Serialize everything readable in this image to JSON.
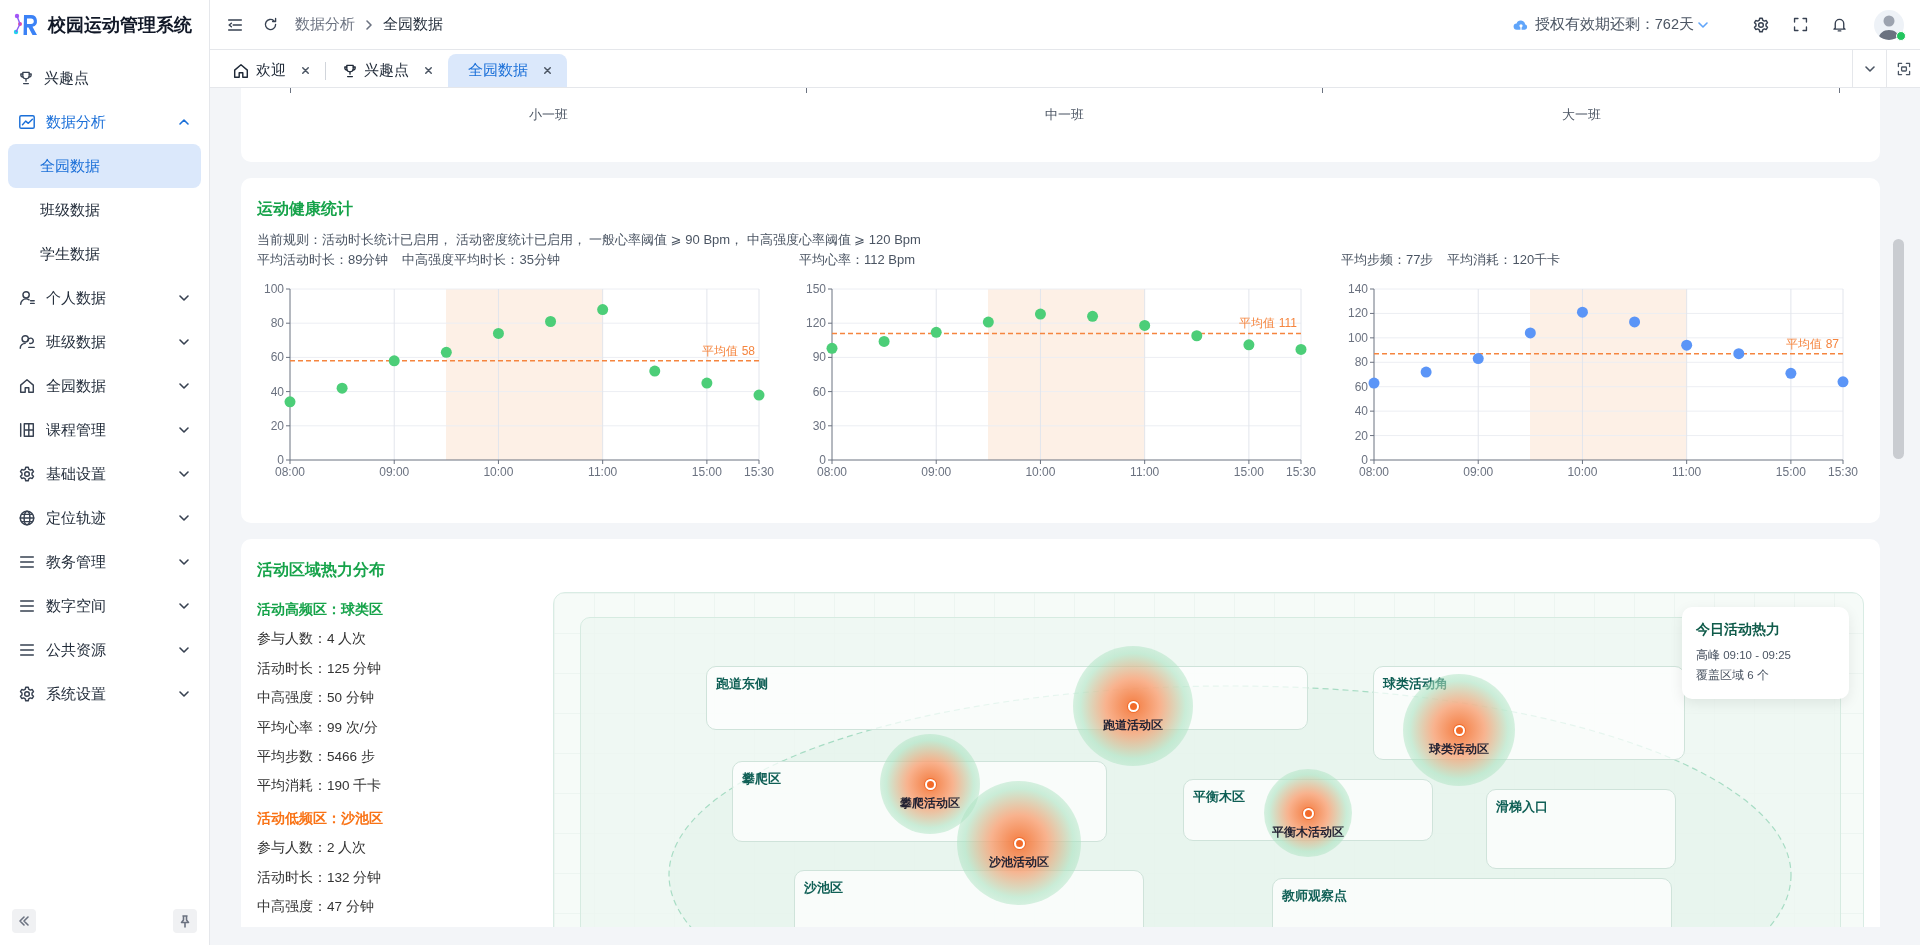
{
  "app": {
    "title": "校园运动管理系统"
  },
  "sidebar": {
    "items": [
      {
        "label": "兴趣点",
        "selected": false
      },
      {
        "label": "数据分析",
        "selected": false,
        "expanded": true,
        "children": [
          {
            "label": "全园数据",
            "selected": true
          },
          {
            "label": "班级数据",
            "selected": false
          },
          {
            "label": "学生数据",
            "selected": false
          }
        ]
      },
      {
        "label": "个人数据",
        "selected": false,
        "expanded": false
      },
      {
        "label": "班级数据",
        "selected": false,
        "expanded": false
      },
      {
        "label": "全园数据",
        "selected": false,
        "expanded": false
      },
      {
        "label": "课程管理",
        "selected": false,
        "expanded": false
      },
      {
        "label": "基础设置",
        "selected": false,
        "expanded": false
      },
      {
        "label": "定位轨迹",
        "selected": false,
        "expanded": false
      },
      {
        "label": "教务管理",
        "selected": false,
        "expanded": false
      },
      {
        "label": "数字空间",
        "selected": false,
        "expanded": false
      },
      {
        "label": "公共资源",
        "selected": false,
        "expanded": false
      },
      {
        "label": "系统设置",
        "selected": false,
        "expanded": false
      }
    ]
  },
  "header": {
    "breadcrumb": [
      "数据分析",
      "全园数据"
    ],
    "license": "授权有效期还剩：762天",
    "user": {
      "online": true
    }
  },
  "tabs": [
    {
      "label": "欢迎",
      "selected": false
    },
    {
      "label": "兴趣点",
      "selected": false
    },
    {
      "label": "全园数据",
      "selected": true
    }
  ],
  "class_chart": {
    "x_labels": [
      "小一班",
      "中一班",
      "大一班"
    ]
  },
  "health": {
    "title": "运动健康统计",
    "rules": "当前规则：活动时长统计已启用， 活动密度统计已启用， 一般心率阈值 ⩾ 90 Bpm， 中高强度心率阈值 ⩾ 120 Bpm",
    "charts": [
      {
        "stats": [
          "平均活动时长：89分钟",
          "中高强度平均时长：35分钟"
        ],
        "chart_data": {
          "type": "scatter",
          "categories": [
            "08:00",
            null,
            "09:00",
            null,
            "10:00",
            null,
            "11:00",
            null,
            "15:00",
            "15:30"
          ],
          "ylim": [
            0,
            100
          ],
          "yticks": [
            0,
            20,
            40,
            60,
            80,
            100
          ],
          "series": [
            {
              "color": "#4cce78",
              "values": [
                34,
                42,
                58,
                63,
                74,
                81,
                88,
                52,
                45,
                38
              ]
            }
          ],
          "grid": true,
          "ref_lines": [
            {
              "axis": "y",
              "value": 58,
              "label": "平均值 58"
            }
          ]
        }
      },
      {
        "stats": [
          "平均心率：112 Bpm"
        ],
        "chart_data": {
          "type": "scatter",
          "categories": [
            "08:00",
            null,
            "09:00",
            null,
            "10:00",
            null,
            "11:00",
            null,
            "15:00",
            "15:30"
          ],
          "ylim": [
            0,
            150
          ],
          "yticks": [
            0,
            30,
            60,
            90,
            120,
            150
          ],
          "series": [
            {
              "color": "#4cce78",
              "values": [
                98,
                104,
                112,
                121,
                128,
                126,
                118,
                109,
                101,
                97
              ]
            }
          ],
          "grid": true,
          "ref_lines": [
            {
              "axis": "y",
              "value": 111,
              "label": "平均值 111"
            }
          ]
        }
      },
      {
        "stats": [
          "平均步频：77步",
          "平均消耗：120千卡"
        ],
        "chart_data": {
          "type": "scatter",
          "categories": [
            "08:00",
            null,
            "09:00",
            null,
            "10:00",
            null,
            "11:00",
            null,
            "15:00",
            "15:30"
          ],
          "ylim": [
            0,
            140
          ],
          "yticks": [
            0,
            20,
            40,
            60,
            80,
            100,
            120,
            140
          ],
          "series": [
            {
              "color": "#5b95f7",
              "values": [
                63,
                72,
                83,
                104,
                121,
                113,
                94,
                87,
                71,
                64
              ]
            }
          ],
          "grid": true,
          "ref_lines": [
            {
              "axis": "y",
              "value": 87,
              "label": "平均值 87"
            }
          ]
        }
      }
    ]
  },
  "heat": {
    "title": "活动区域热力分布",
    "groups": [
      {
        "kind": "high",
        "title": "活动高频区：球类区",
        "stats": [
          "参与人数：4 人次",
          "活动时长：125 分钟",
          "中高强度：50 分钟",
          "平均心率：99 次/分",
          "平均步数：5466 步",
          "平均消耗：190 千卡"
        ]
      },
      {
        "kind": "low",
        "title": "活动低频区：沙池区",
        "stats": [
          "参与人数：2 人次",
          "活动时长：132 分钟",
          "中高强度：47 分钟"
        ]
      }
    ],
    "zones": [
      {
        "label": "跑道东侧"
      },
      {
        "label": "球类活动角"
      },
      {
        "label": "攀爬区"
      },
      {
        "label": "平衡木区"
      },
      {
        "label": "滑梯入口"
      },
      {
        "label": "沙池区"
      },
      {
        "label": "教师观察点"
      }
    ],
    "hotspots": [
      {
        "label": "跑道活动区"
      },
      {
        "label": "球类活动区"
      },
      {
        "label": "攀爬活动区"
      },
      {
        "label": "沙池活动区"
      },
      {
        "label": "平衡木活动区"
      }
    ],
    "summary": {
      "title": "今日活动热力",
      "lines": [
        "高峰 09:10 - 09:25",
        "覆盖区域 6 个"
      ]
    }
  }
}
